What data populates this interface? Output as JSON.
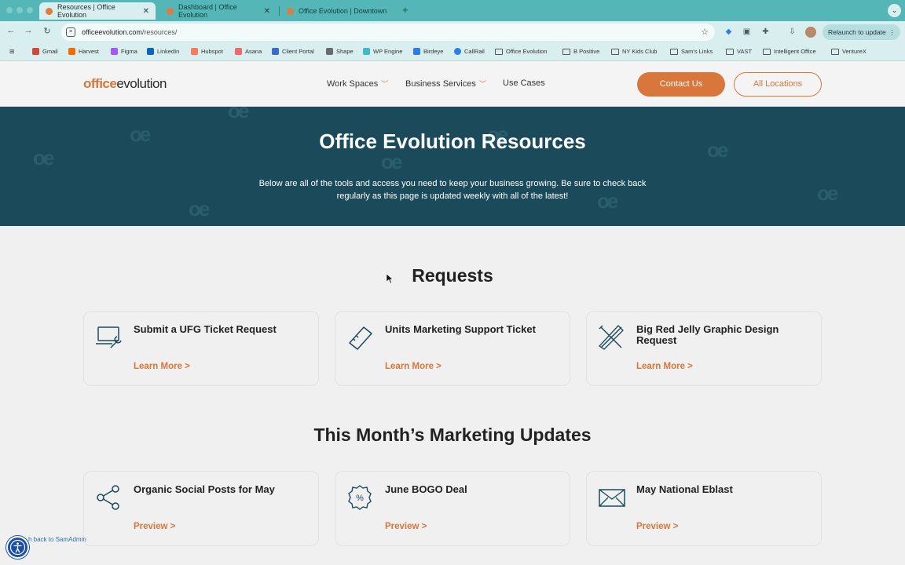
{
  "browser": {
    "tabs": [
      {
        "label": "Resources | Office Evolution",
        "active": true
      },
      {
        "label": "Dashboard | Office Evolution",
        "active": false
      },
      {
        "label": "Office Evolution | Downtown",
        "active": false
      }
    ],
    "new_tab": "+",
    "url_domain": "officeevolution.com",
    "url_path": "/resources/",
    "relaunch_label": "Relaunch to update",
    "bookmarks": [
      {
        "label": "Gmail",
        "icon": "gmail-icon",
        "color": "#d44638"
      },
      {
        "label": "Harvest",
        "icon": "harvest-icon",
        "color": "#f36c00"
      },
      {
        "label": "Figma",
        "icon": "figma-icon",
        "color": "#a259ff"
      },
      {
        "label": "LinkedIn",
        "icon": "linkedin-icon",
        "color": "#0a66c2"
      },
      {
        "label": "Hubspot",
        "icon": "hubspot-icon",
        "color": "#ff7a59"
      },
      {
        "label": "Asana",
        "icon": "asana-icon",
        "color": "#f06a6a"
      },
      {
        "label": "Client Portal",
        "icon": "client-portal-icon",
        "color": "#3b6bd1"
      },
      {
        "label": "Shape",
        "icon": "shape-icon",
        "color": "#6b6b6b"
      },
      {
        "label": "WP Engine",
        "icon": "wpengine-icon",
        "color": "#40bac8"
      },
      {
        "label": "Birdeye",
        "icon": "birdeye-icon",
        "color": "#2b7de9"
      },
      {
        "label": "CallRail",
        "icon": "callrail-icon",
        "color": "#2b7de9"
      },
      {
        "label": "Office Evolution",
        "icon": "folder-icon",
        "color": "#555555"
      },
      {
        "label": "B Positive",
        "icon": "folder-icon",
        "color": "#555555"
      },
      {
        "label": "NY Kids Club",
        "icon": "folder-icon",
        "color": "#555555"
      },
      {
        "label": "Sam's Links",
        "icon": "folder-icon",
        "color": "#555555"
      },
      {
        "label": "VAST",
        "icon": "folder-icon",
        "color": "#555555"
      },
      {
        "label": "Intelligent Office",
        "icon": "folder-icon",
        "color": "#555555"
      },
      {
        "label": "VentureX",
        "icon": "folder-icon",
        "color": "#555555"
      }
    ]
  },
  "site": {
    "logo_part1": "office",
    "logo_part2": "evolution",
    "nav": [
      {
        "label": "Work Spaces",
        "has_dropdown": true
      },
      {
        "label": "Business Services",
        "has_dropdown": true
      },
      {
        "label": "Use Cases",
        "has_dropdown": false
      }
    ],
    "contact_label": "Contact Us",
    "locations_label": "All Locations",
    "accent_color": "#d9763c",
    "hero_color": "#1b4a5b"
  },
  "hero": {
    "title": "Office Evolution Resources",
    "subtitle": "Below are all of the tools and access you need to keep your business growing. Be sure to check back regularly as this page is updated weekly with all of the latest!"
  },
  "requests": {
    "title": "Requests",
    "cards": [
      {
        "title": "Submit a UFG Ticket Request",
        "link": "Learn More >",
        "icon": "laptop-wrench-icon"
      },
      {
        "title": "Units Marketing Support Ticket",
        "link": "Learn More >",
        "icon": "ticket-icon"
      },
      {
        "title": "Big Red Jelly Graphic Design Request",
        "link": "Learn More >",
        "icon": "design-tools-icon"
      }
    ]
  },
  "marketing": {
    "title": "This Month’s Marketing Updates",
    "cards": [
      {
        "title": "Organic Social Posts for May",
        "link": "Preview >",
        "icon": "share-icon"
      },
      {
        "title": "June BOGO Deal",
        "link": "Preview >",
        "icon": "percent-badge-icon"
      },
      {
        "title": "May National Eblast",
        "link": "Preview >",
        "icon": "envelope-icon"
      }
    ]
  },
  "footer": {
    "samadmin_label": "h back to SamAdmin"
  }
}
